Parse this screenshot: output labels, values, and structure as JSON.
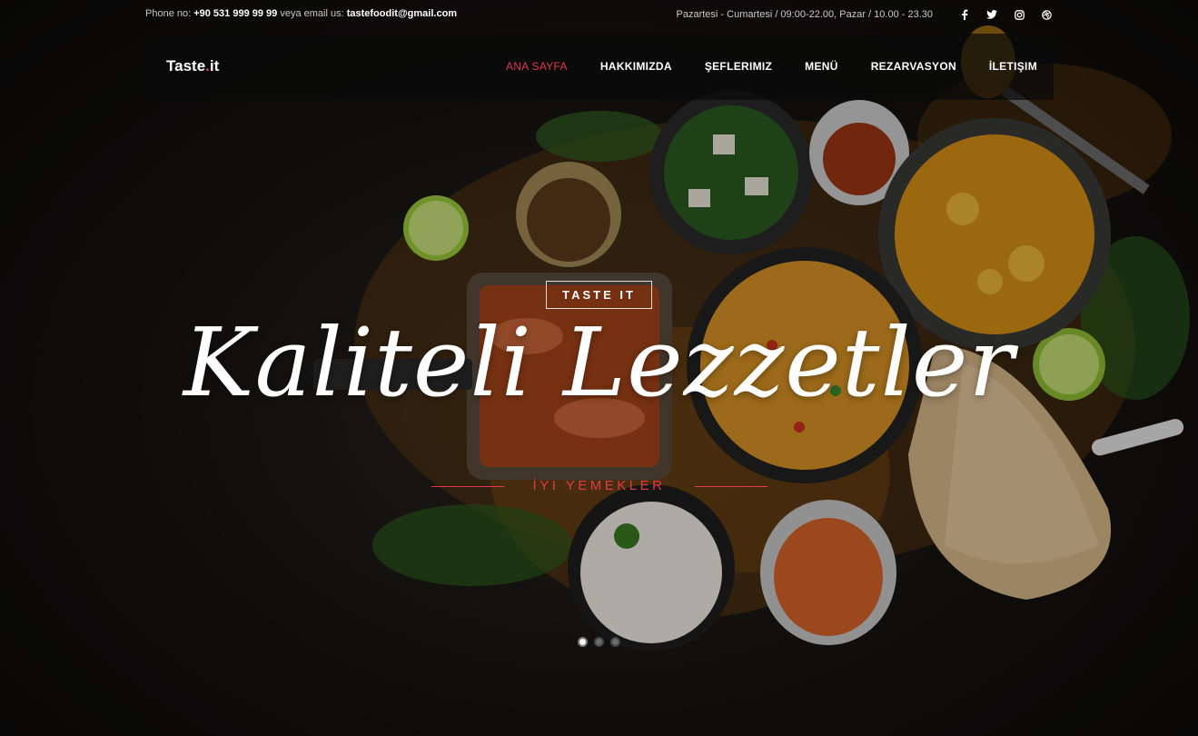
{
  "topbar": {
    "phone_label": "Phone no:",
    "phone": "+90 531 999 99 99",
    "email_label": "veya email us:",
    "email": "tastefoodit@gmail.com",
    "hours": "Pazartesi - Cumartesi / 09:00-22.00, Pazar / 10.00 - 23.30",
    "social_icons": [
      "facebook-icon",
      "twitter-icon",
      "instagram-icon",
      "dribbble-icon"
    ]
  },
  "brand": {
    "name": "Taste",
    "dot": ".",
    "suffix": "it"
  },
  "nav": {
    "items": [
      {
        "label": "ANA SAYFA",
        "active": true
      },
      {
        "label": "HAKKIMIZDA",
        "active": false
      },
      {
        "label": "ŞEFLERIMIZ",
        "active": false
      },
      {
        "label": "MENÜ",
        "active": false
      },
      {
        "label": "REZARVASYON",
        "active": false
      },
      {
        "label": "İLETIŞIM",
        "active": false
      }
    ]
  },
  "hero": {
    "tag": "TASTE IT",
    "headline": "Kaliteli Lezzetler",
    "subheadline": "İYI YEMEKLER"
  },
  "carousel": {
    "slides": 3,
    "active_index": 0
  },
  "colors": {
    "accent": "#e03a4e",
    "navbar_bg": "#0a0a0a",
    "text": "#ffffff"
  }
}
